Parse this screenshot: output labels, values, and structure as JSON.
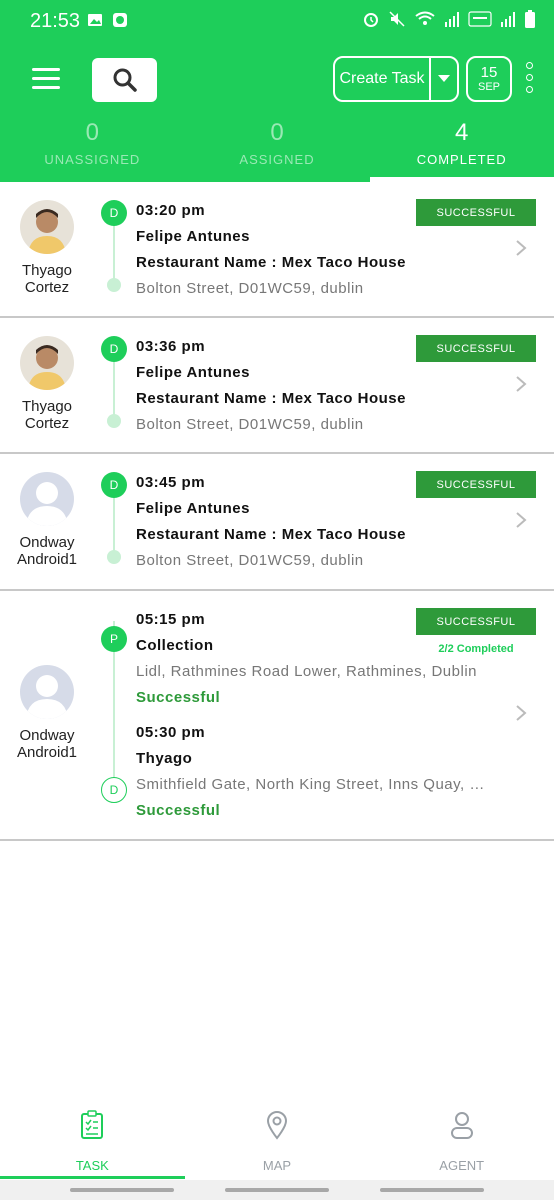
{
  "status_bar": {
    "time": "21:53"
  },
  "header": {
    "create_task_label": "Create Task",
    "date_day": "15",
    "date_month": "SEP",
    "accent": "#1ece5a"
  },
  "tabs": [
    {
      "count": "0",
      "label": "UNASSIGNED"
    },
    {
      "count": "0",
      "label": "ASSIGNED"
    },
    {
      "count": "4",
      "label": "COMPLETED",
      "active": true
    }
  ],
  "tasks": [
    {
      "agent": {
        "first": "Thyago",
        "last": "Cortez",
        "avatar": "photo"
      },
      "badge": "D",
      "time": "03:20 pm",
      "customer": "Felipe Antunes",
      "restaurant": "Restaurant Name : Mex Taco House",
      "address": "Bolton Street, D01WC59, dublin",
      "status": "SUCCESSFUL"
    },
    {
      "agent": {
        "first": "Thyago",
        "last": "Cortez",
        "avatar": "photo"
      },
      "badge": "D",
      "time": "03:36 pm",
      "customer": "Felipe Antunes",
      "restaurant": "Restaurant Name : Mex Taco House",
      "address": "Bolton Street, D01WC59, dublin",
      "status": "SUCCESSFUL"
    },
    {
      "agent": {
        "first": "Ondway",
        "last": "Android1",
        "avatar": "placeholder"
      },
      "badge": "D",
      "time": "03:45 pm",
      "customer": "Felipe Antunes",
      "restaurant": "Restaurant Name : Mex Taco House",
      "address": "Bolton Street, D01WC59, dublin",
      "status": "SUCCESSFUL"
    },
    {
      "agent": {
        "first": "Ondway",
        "last": "Android1",
        "avatar": "placeholder"
      },
      "status": "SUCCESSFUL",
      "progress": "2/2 Completed",
      "pickup": {
        "badge": "P",
        "time": "05:15 pm",
        "name": "Collection",
        "address": "Lidl, Rathmines Road Lower, Rathmines, Dublin",
        "status": "Successful"
      },
      "delivery": {
        "badge": "D",
        "time": "05:30 pm",
        "name": "Thyago",
        "address": "Smithfield Gate, North King Street, Inns Quay, Dublin",
        "status": "Successful"
      }
    }
  ],
  "bottom_nav": [
    {
      "label": "TASK",
      "icon": "clipboard-icon",
      "active": true
    },
    {
      "label": "MAP",
      "icon": "map-pin-icon"
    },
    {
      "label": "AGENT",
      "icon": "person-icon"
    }
  ]
}
